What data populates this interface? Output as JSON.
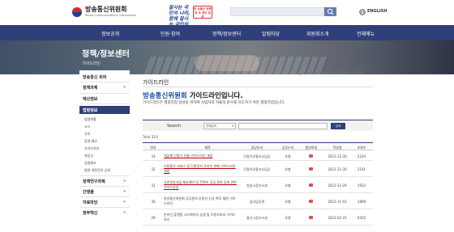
{
  "header": {
    "logo_title": "방송통신위원회",
    "logo_sub": "Korea Communications Commission",
    "slogan": "잘사는 국민의 나라, 함께 잘사는 국민의 나라",
    "badge": "방 송통신 정부 업 무 혁신 방향",
    "language": "ENGLISH"
  },
  "gnb": [
    "정보공개",
    "민원·참여",
    "정책/정보센터",
    "알림마당",
    "위원회소개",
    "전체메뉴"
  ],
  "banner": {
    "title": "정책/정보센터",
    "subtitle": "가이드라인"
  },
  "lnb": {
    "menus": [
      "방송통신 회의",
      "정책과제",
      "예산정보",
      "법령정보"
    ],
    "active": "법령정보",
    "subs": [
      "법령현황",
      "고시",
      "규칙",
      "훈령·예규",
      "가이드라인",
      "위임규",
      "입법예고",
      "법령 개정건의 공개"
    ],
    "menus_after": [
      "정책연구과제",
      "간행물",
      "자료마당",
      "정부혁신"
    ]
  },
  "breadcrumb": "HOME  >  정책/정보센터  >  법령정보  >  가이드라인",
  "page": {
    "heading": "가이드라인",
    "headline_em": "방송통신위원회",
    "headline_rest": " 가이드라인입니다.",
    "description": "가이드라인은 행정지침 달성을 위하여 사업자의 자율적 준수를 유도하기 위한 행정지침입니다."
  },
  "filter": {
    "label": "Search",
    "select": "전체검색",
    "button": "검색"
  },
  "total": {
    "label": "Total",
    "count": "33",
    "unit": "건"
  },
  "table": {
    "headers": [
      "번호",
      "제목",
      "담당부서",
      "공공누리",
      "첨부파일",
      "작성일",
      "조회수"
    ],
    "rows": [
      {
        "no": "33",
        "title": "개금제 단말기 유통 가이드라인 개정",
        "dept": "단말기유통조사담당",
        "type": "유형",
        "date": "2021-12-30",
        "views": "2104"
      },
      {
        "no": "32",
        "title": "이동통신 서비스 및 단말장치 온라인 판매 가이드라인 개정",
        "dept": "단말기유통조사담당",
        "type": "유형",
        "date": "2021-12-30",
        "views": "2141"
      },
      {
        "no": "31",
        "title": "유료방송사업 채널계약 및 콘텐츠 공급 절차 등에 관한 가이드라인",
        "dept": "방송시장조사과",
        "type": "유형",
        "date": "2021-12-29",
        "views": "1933"
      },
      {
        "no": "30",
        "title": "방송통신위원회 공무원의 부동산 신규 취득 제한 가이드라인",
        "dept": "감사담당관",
        "type": "유형",
        "date": "2021-11-03",
        "views": "1898"
      },
      {
        "no": "29",
        "title": "온라인 플랫폼 크리에이터 상생 및 이용자보호 가이드라인",
        "dept": "통신시장조사과",
        "type": "유형",
        "date": "2021-02-25",
        "views": "6350"
      }
    ]
  }
}
